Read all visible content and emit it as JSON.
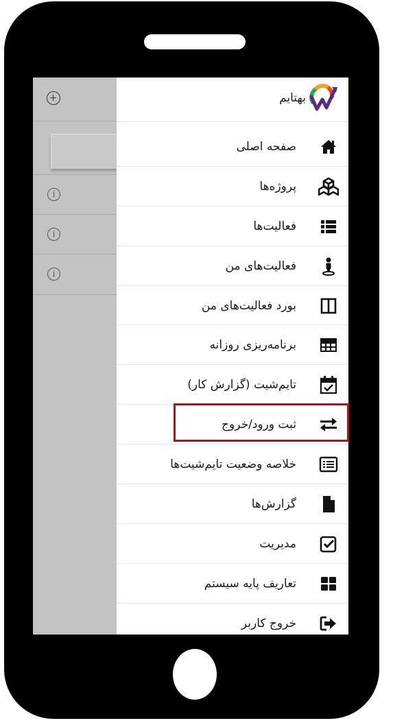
{
  "brand": {
    "name": "بهتایم",
    "logo_icon": "behtime-logo"
  },
  "background_panel": {
    "add_icon": "plus-circle-icon",
    "info_icon": "info-circle-icon"
  },
  "menu": [
    {
      "label": "صفحه اصلی",
      "icon": "home-icon"
    },
    {
      "label": "پروژه‌ها",
      "icon": "cubes-icon"
    },
    {
      "label": "فعالیت‌ها",
      "icon": "list-icon"
    },
    {
      "label": "فعالیت‌های من",
      "icon": "user-pin-icon"
    },
    {
      "label": "بورد فعالیت‌های من",
      "icon": "columns-icon"
    },
    {
      "label": "برنامه‌ریزی روزانه",
      "icon": "table-icon"
    },
    {
      "label": "تایم‌شیت (گزارش کار)",
      "icon": "calendar-check-icon"
    },
    {
      "label": "ثبت ورود/خروج",
      "icon": "exchange-icon",
      "highlighted": true
    },
    {
      "label": "خلاصه وضعیت تایم‌شیت‌ها",
      "icon": "list-alt-icon"
    },
    {
      "label": "گزارش‌ها",
      "icon": "file-icon"
    },
    {
      "label": "مدیریت",
      "icon": "check-square-icon"
    },
    {
      "label": "تعاریف پایه سیستم",
      "icon": "grid-icon"
    },
    {
      "label": "خروج کاربر",
      "icon": "sign-out-icon"
    }
  ],
  "colors": {
    "highlight_border": "#b4121b",
    "panel_grey": "#c3c3c3",
    "phone_body": "#000000"
  }
}
